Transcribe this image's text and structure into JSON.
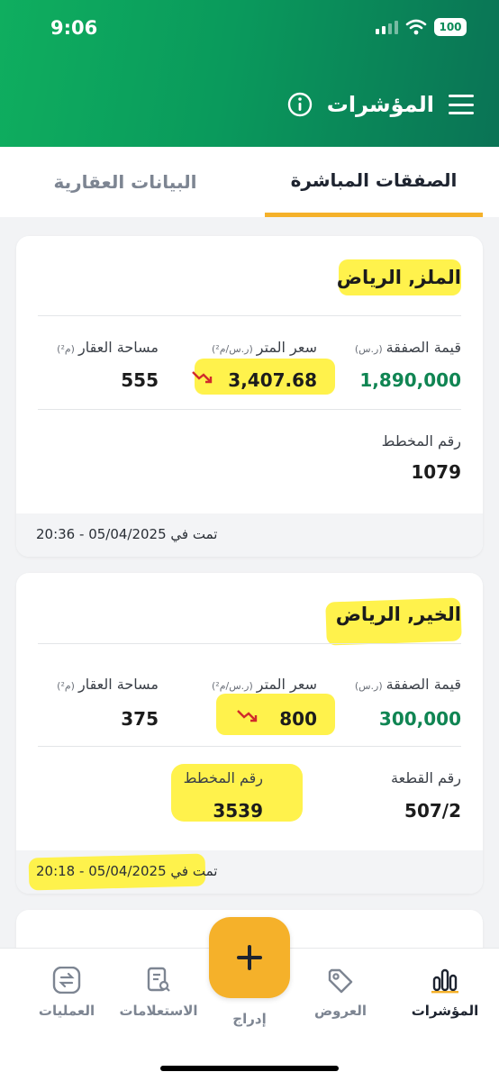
{
  "status_bar": {
    "time": "9:06",
    "battery": "100"
  },
  "header": {
    "title": "المؤشرات"
  },
  "tabs": [
    {
      "label": "الصفقات المباشرة",
      "active": true
    },
    {
      "label": "البيانات العقارية",
      "active": false
    }
  ],
  "deals": [
    {
      "location": "الملز, الرياض",
      "deal_value_label": "قيمة الصفقة",
      "deal_value_unit": "(ر.س)",
      "deal_value": "1,890,000",
      "meter_price_label": "سعر المتر",
      "meter_price_unit": "(ر.س/م²)",
      "meter_price": "3,407.68",
      "area_label": "مساحة العقار",
      "area_unit": "(م²)",
      "area": "555",
      "plan_label": "رقم المخطط",
      "plan_number": "1079",
      "completed": "تمت في 05/04/2025 - 20:36"
    },
    {
      "location": "الخير, الرياض",
      "deal_value_label": "قيمة الصفقة",
      "deal_value_unit": "(ر.س)",
      "deal_value": "300,000",
      "meter_price_label": "سعر المتر",
      "meter_price_unit": "(ر.س/م²)",
      "meter_price": "800",
      "area_label": "مساحة العقار",
      "area_unit": "(م²)",
      "area": "375",
      "plot_label": "رقم القطعة",
      "plot_number": "507/2",
      "plan_label": "رقم المخطط",
      "plan_number": "3539",
      "completed": "تمت في 05/04/2025 - 20:18"
    }
  ],
  "bottom_nav": {
    "indicators": "المؤشرات",
    "offers": "العروض",
    "add": "إدراج",
    "inquiries": "الاستعلامات",
    "operations": "العمليات"
  },
  "colors": {
    "brand_green": "#0a9a5c",
    "accent": "#f5b12a",
    "value_green": "#108553",
    "highlight": "#fff13d"
  }
}
